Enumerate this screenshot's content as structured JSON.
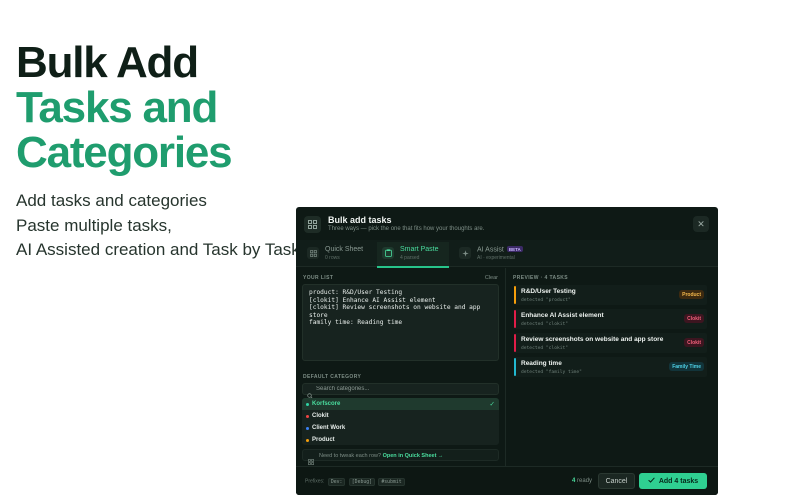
{
  "hero": {
    "line1": "Bulk Add",
    "line2": "Tasks and",
    "line3": "Categories",
    "desc": [
      "Add tasks and categories",
      "Paste multiple tasks,",
      "AI Assisted creation and Task by Task."
    ]
  },
  "dialog": {
    "title": "Bulk add tasks",
    "subtitle": "Three ways — pick the one that fits how your thoughts are.",
    "close_icon": "close-icon",
    "tabs": [
      {
        "label": "Quick Sheet",
        "sub": "0 rows",
        "icon": "grid-icon",
        "active": false
      },
      {
        "label": "Smart Paste",
        "sub": "4 parsed",
        "icon": "clipboard-icon",
        "active": true
      },
      {
        "label": "AI Assist",
        "sub": "AI · experimental",
        "icon": "sparkle-icon",
        "badge": "BETA",
        "active": false
      }
    ],
    "your_list": {
      "label": "YOUR LIST",
      "clear": "Clear",
      "lines": [
        "product: R&D/User Testing",
        "[clokit] Enhance AI Assist element",
        "[clokit] Review screenshots on website and app",
        "store",
        "family time: Reading time"
      ]
    },
    "default_category": {
      "label": "DEFAULT CATEGORY",
      "search_placeholder": "Search categories...",
      "items": [
        {
          "name": "Korfscore",
          "color": "#2fd3a4",
          "selected": true
        },
        {
          "name": "Clokit",
          "color": "#ef4444",
          "selected": false
        },
        {
          "name": "Client Work",
          "color": "#3b82f6",
          "selected": false
        },
        {
          "name": "Product",
          "color": "#f59e0b",
          "selected": false
        }
      ],
      "check": "✓"
    },
    "tweak": {
      "text": "Need to tweak each row?",
      "link": "Open in Quick Sheet →"
    },
    "preview": {
      "label": "PREVIEW · 4 TASKS",
      "items": [
        {
          "title": "R&D/User Testing",
          "detected": "detected \"product\"",
          "badge": "Product",
          "color": "#f59e0b",
          "badge_bg": "#3d2a10",
          "badge_fg": "#f5b94c"
        },
        {
          "title": "Enhance AI Assist element",
          "detected": "detected \"clokit\"",
          "badge": "Clokit",
          "color": "#e11d48",
          "badge_bg": "#3d1520",
          "badge_fg": "#f0607a"
        },
        {
          "title": "Review screenshots on website and app store",
          "detected": "detected \"clokit\"",
          "badge": "Clokit",
          "color": "#e11d48",
          "badge_bg": "#3d1520",
          "badge_fg": "#f0607a"
        },
        {
          "title": "Reading time",
          "detected": "detected \"family time\"",
          "badge": "Family Time",
          "color": "#22b8cf",
          "badge_bg": "#12343a",
          "badge_fg": "#4fd1e6"
        }
      ]
    },
    "footer": {
      "prefixes_label": "Prefixes:",
      "prefixes": [
        "Dev:",
        "[Debug]",
        "#submit"
      ],
      "ready_count": "4",
      "ready_text": "ready",
      "cancel": "Cancel",
      "add": "Add 4 tasks",
      "add_icon": "check-icon"
    }
  }
}
